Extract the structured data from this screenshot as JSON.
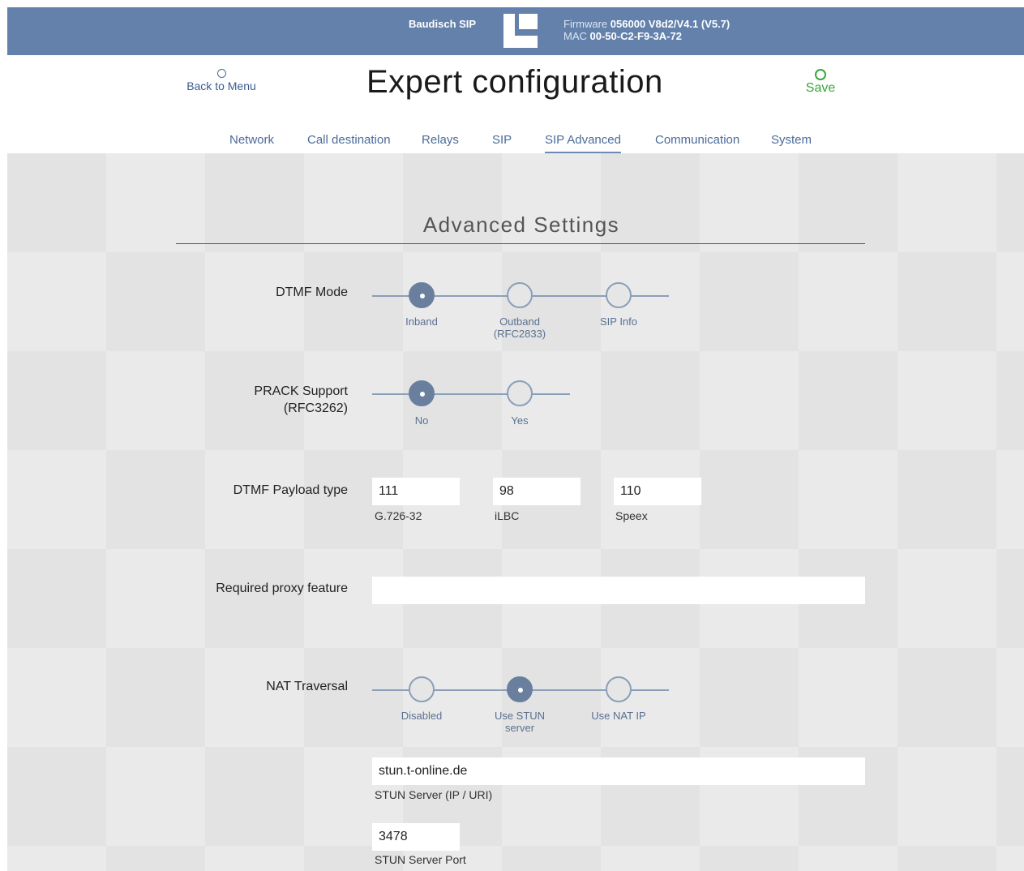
{
  "topbar": {
    "device_name": "Baudisch SIP",
    "firmware_label": "Firmware",
    "firmware_value": "056000 V8d2/V4.1 (V5.7)",
    "mac_label": "MAC",
    "mac_value": "00-50-C2-F9-3A-72"
  },
  "header": {
    "back_label": "Back to Menu",
    "title": "Expert configuration",
    "save_label": "Save"
  },
  "tabs": [
    {
      "label": "Network"
    },
    {
      "label": "Call destination"
    },
    {
      "label": "Relays"
    },
    {
      "label": "SIP"
    },
    {
      "label": "SIP Advanced",
      "active": true
    },
    {
      "label": "Communication"
    },
    {
      "label": "System"
    }
  ],
  "section": {
    "title": "Advanced Settings"
  },
  "dtmf_mode": {
    "label": "DTMF Mode",
    "options": [
      {
        "label": "Inband",
        "selected": true
      },
      {
        "label": "Outband (RFC2833)",
        "selected": false
      },
      {
        "label": "SIP Info",
        "selected": false
      }
    ]
  },
  "prack": {
    "label": "PRACK Support (RFC3262)",
    "options": [
      {
        "label": "No",
        "selected": true
      },
      {
        "label": "Yes",
        "selected": false
      }
    ]
  },
  "dtmf_payload": {
    "label": "DTMF Payload type",
    "fields": [
      {
        "value": "111",
        "caption": "G.726-32"
      },
      {
        "value": "98",
        "caption": "iLBC"
      },
      {
        "value": "110",
        "caption": "Speex"
      }
    ]
  },
  "proxy_feature": {
    "label": "Required proxy feature",
    "value": ""
  },
  "nat": {
    "label": "NAT Traversal",
    "options": [
      {
        "label": "Disabled",
        "selected": false
      },
      {
        "label": "Use STUN server",
        "selected": true
      },
      {
        "label": "Use NAT IP",
        "selected": false
      }
    ],
    "stun_server": {
      "value": "stun.t-online.de",
      "caption": "STUN Server (IP / URI)"
    },
    "stun_port": {
      "value": "3478",
      "caption": "STUN Server Port"
    }
  },
  "colors": {
    "topbar": "#6381ab",
    "accent": "#6a7f9e",
    "save": "#3aa53a"
  }
}
